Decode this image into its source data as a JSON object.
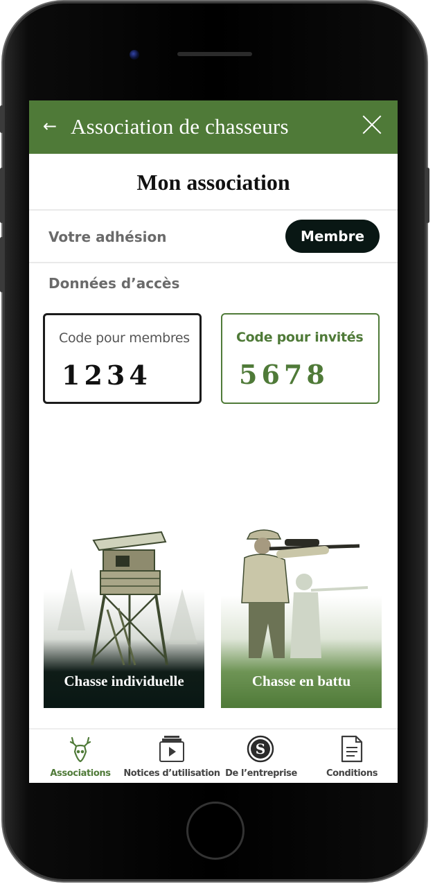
{
  "app": {
    "title": "Association de chasseurs",
    "back_icon": "arrow-left-icon",
    "close_icon": "close-icon",
    "accent_color": "#4f7a38",
    "dark_color": "#091714"
  },
  "page": {
    "title": "Mon association"
  },
  "membership": {
    "label": "Votre adhésion",
    "status": "Membre"
  },
  "access": {
    "label": "Données d’accès",
    "members_code": {
      "label": "Code pour membres",
      "value": "1234"
    },
    "guests_code": {
      "label": "Code pour invités",
      "value": "5678"
    }
  },
  "hunts": [
    {
      "label": "Chasse individuelle",
      "icon": "hunting-tower-image"
    },
    {
      "label": "Chasse en battu",
      "icon": "hunter-rifle-image"
    }
  ],
  "tabs": [
    {
      "label": "Associations",
      "icon": "deer-icon",
      "active": true
    },
    {
      "label": "Notices d’utilisation",
      "icon": "video-play-icon",
      "active": false
    },
    {
      "label": "De l’entreprise",
      "icon": "company-logo-icon",
      "active": false
    },
    {
      "label": "Conditions",
      "icon": "document-icon",
      "active": false
    }
  ]
}
